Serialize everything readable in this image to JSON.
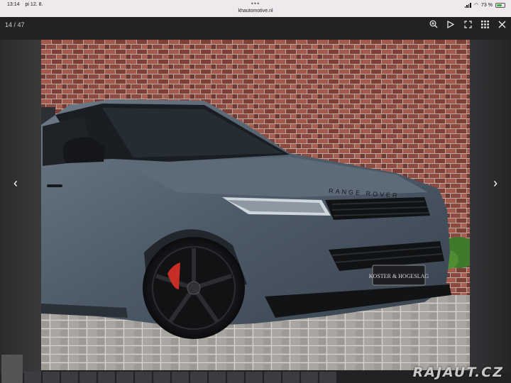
{
  "status_bar": {
    "time": "13:14",
    "date": "pi 12. 8.",
    "url": "khautomotive.nl",
    "battery": "73 %"
  },
  "gallery": {
    "counter": "14 / 47",
    "tools": [
      "zoom-in-icon",
      "play-icon",
      "fullscreen-icon",
      "grid-icon",
      "close-icon"
    ]
  },
  "photo": {
    "bonnet_lettering": "RANGE ROVER",
    "plate_text": "KOSTER & HOGESLAG"
  },
  "watermark": "RAJAUT.CZ"
}
